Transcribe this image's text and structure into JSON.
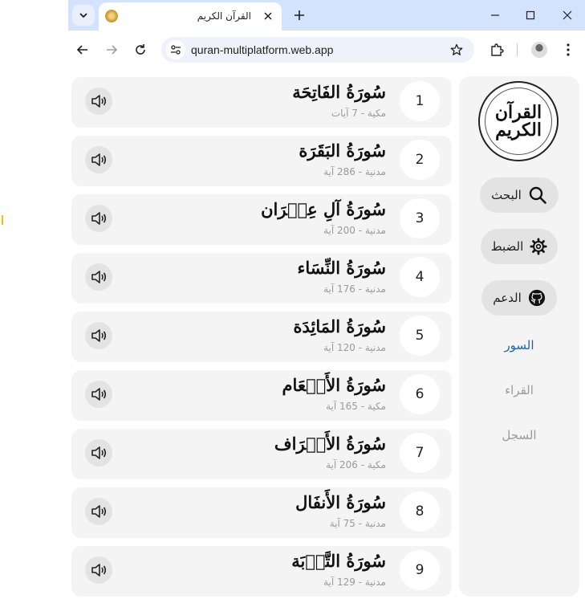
{
  "browser": {
    "tab_title": "القرآن الكريم",
    "url": "quran-multiplatform.web.app"
  },
  "surahs": [
    {
      "number": "1",
      "name": "سُورَةُ الفَاتِحَة",
      "info": "مكية - 7 آيات"
    },
    {
      "number": "2",
      "name": "سُورَةُ البَقَرَة",
      "info": "مدنية - 286 آية"
    },
    {
      "number": "3",
      "name": "سُورَةُ آلِ عِمۡرَان",
      "info": "مدنية - 200 آية"
    },
    {
      "number": "4",
      "name": "سُورَةُ النِّسَاء",
      "info": "مدنية - 176 آية"
    },
    {
      "number": "5",
      "name": "سُورَةُ المَائِدَة",
      "info": "مدنية - 120 آية"
    },
    {
      "number": "6",
      "name": "سُورَةُ الأَنۡعَام",
      "info": "مكية - 165 آية"
    },
    {
      "number": "7",
      "name": "سُورَةُ الأَعۡرَاف",
      "info": "مكية - 206 آية"
    },
    {
      "number": "8",
      "name": "سُورَةُ الأَنفَال",
      "info": "مدنية - 75 آية"
    },
    {
      "number": "9",
      "name": "سُورَةُ التَّوۡبَة",
      "info": "مدنية - 129 آية"
    }
  ],
  "sidebar": {
    "logo_text": "القرآن الكريم",
    "search_label": "البحث",
    "settings_label": "الضبط",
    "support_label": "الدعم",
    "links": [
      {
        "label": "السور",
        "active": true
      },
      {
        "label": "القراء",
        "active": false
      },
      {
        "label": "السجل",
        "active": false
      }
    ]
  },
  "colors": {
    "active_link": "#1565c0",
    "inactive_link": "#9a9a9a",
    "tab_strip": "#d3e3fd"
  }
}
